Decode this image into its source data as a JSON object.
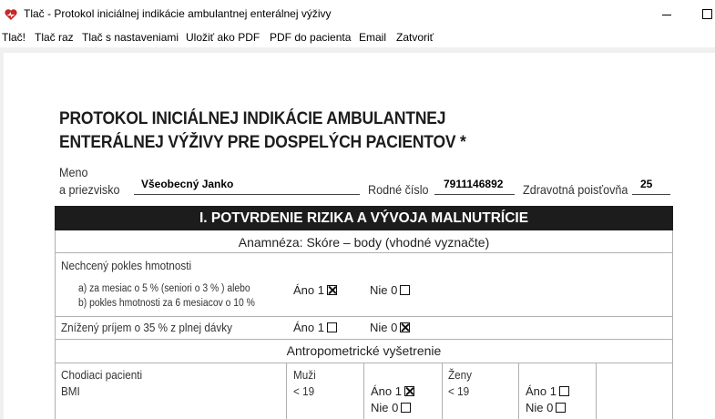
{
  "window": {
    "title": "Tlač - Protokol iniciálnej indikácie ambulantnej enterálnej výživy"
  },
  "menu": [
    "Tlač!",
    "Tlač raz",
    "Tlač s nastaveniami",
    "Uložiť ako PDF",
    "PDF do pacienta",
    "Email",
    "Zatvoriť"
  ],
  "document": {
    "title_line1": "PROTOKOL INICIÁLNEJ INDIKÁCIE AMBULANTNEJ",
    "title_line2": "ENTERÁLNEJ VÝŽIVY PRE DOSPELÝCH PACIENTOV *",
    "patient": {
      "name_label_1": "Meno",
      "name_label_2": "a priezvisko",
      "name_value": "Všeobecný Janko",
      "rc_label": "Rodné číslo",
      "rc_value": "7911146892",
      "insurer_label": "Zdravotná poisťovňa",
      "insurer_value": "25"
    },
    "section1": {
      "title": "I. POTVRDENIE RIZIKA A VÝVOJA MALNUTRÍCIE",
      "anamneza_head": "Anamnéza: Skóre – body (vhodné vyznačte)",
      "weight_loss": {
        "label": "Nechcený pokles hmotnosti",
        "sub_a": "a) za mesiac o 5 % (seniori o 3 % )  alebo",
        "sub_b": "b) pokles hmotnosti za 6 mesiacov o 10 %",
        "yes_label": "Áno 1",
        "no_label": "Nie 0",
        "yes_checked": true,
        "no_checked": false
      },
      "intake": {
        "label": "Znížený príjem o 35 % z plnej dávky",
        "yes_label": "Áno 1",
        "no_label": "Nie 0",
        "yes_checked": false,
        "no_checked": true
      },
      "antropo_head": "Antropometrické vyšetrenie",
      "bmi": {
        "label_1": "Chodiaci pacienti",
        "label_2": "BMI",
        "men_label": "Muži",
        "men_value": "< 19",
        "men_yes": "Áno 1",
        "men_no": "Nie  0",
        "men_yes_checked": true,
        "men_no_checked": false,
        "women_label": "Ženy",
        "women_value": "< 19",
        "women_yes": "Áno 1",
        "women_no": "Nie  0",
        "women_yes_checked": false,
        "women_no_checked": false
      }
    }
  },
  "icons": {
    "app": "heart-icon",
    "app_color": "#c62828",
    "header_bar_color": "#1c1c1c"
  }
}
